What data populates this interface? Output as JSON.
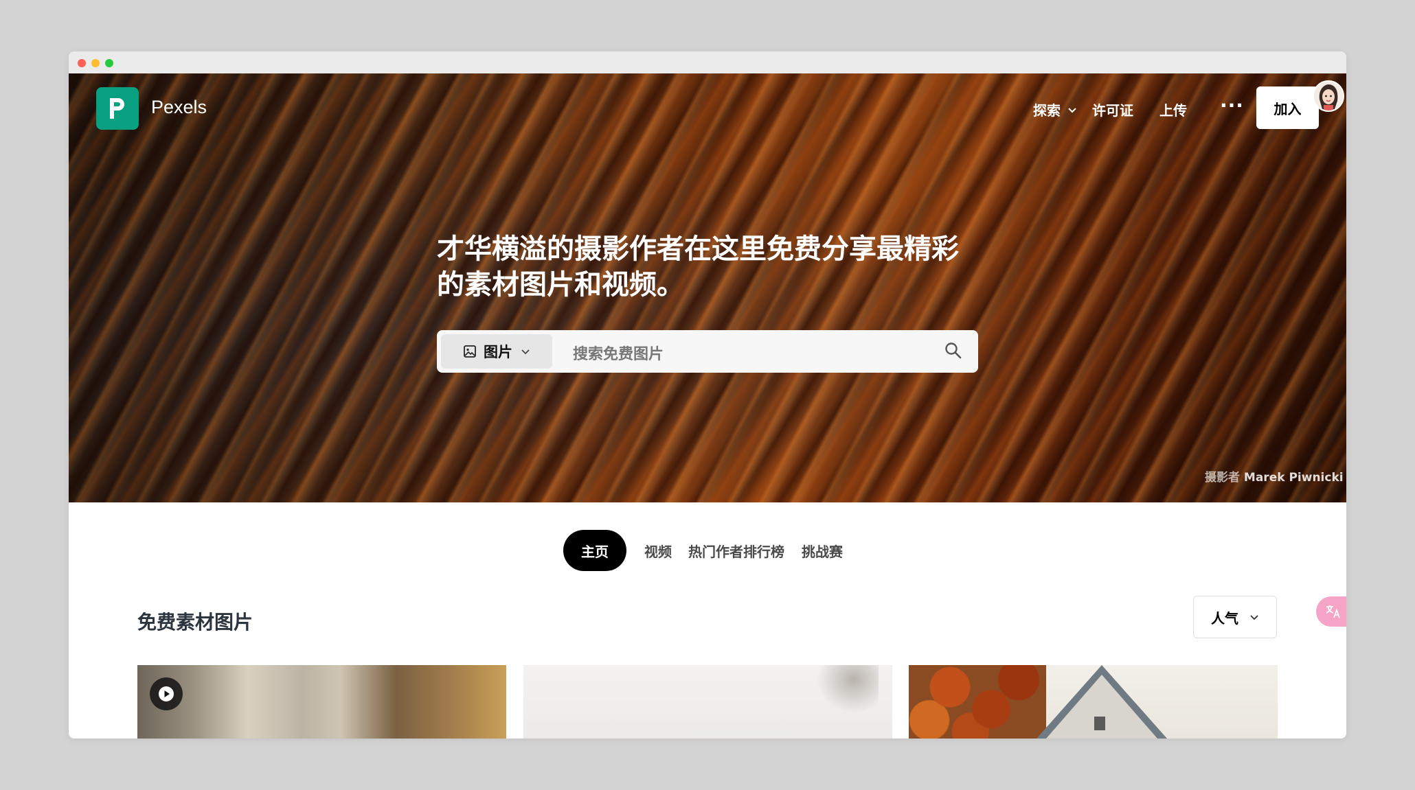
{
  "header": {
    "brand": "Pexels",
    "nav": {
      "explore": "探索",
      "license": "许可证",
      "upload": "上传",
      "more": "···",
      "join": "加入"
    }
  },
  "hero": {
    "headline_line1": "才华横溢的摄影作者在这里免费分享最精彩",
    "headline_line2": "的素材图片和视频。",
    "search": {
      "type_label": "图片",
      "placeholder": "搜索免费图片"
    },
    "credit_prefix": "摄影者",
    "credit_name": "Marek Piwnicki"
  },
  "tabs": {
    "home": "主页",
    "videos": "视频",
    "leaderboard": "热门作者排行榜",
    "challenges": "挑战赛"
  },
  "section": {
    "title": "免费素材图片",
    "sort": "人气"
  },
  "colors": {
    "brand_green": "#07a081",
    "translate_pink": "#f5a3c7"
  }
}
